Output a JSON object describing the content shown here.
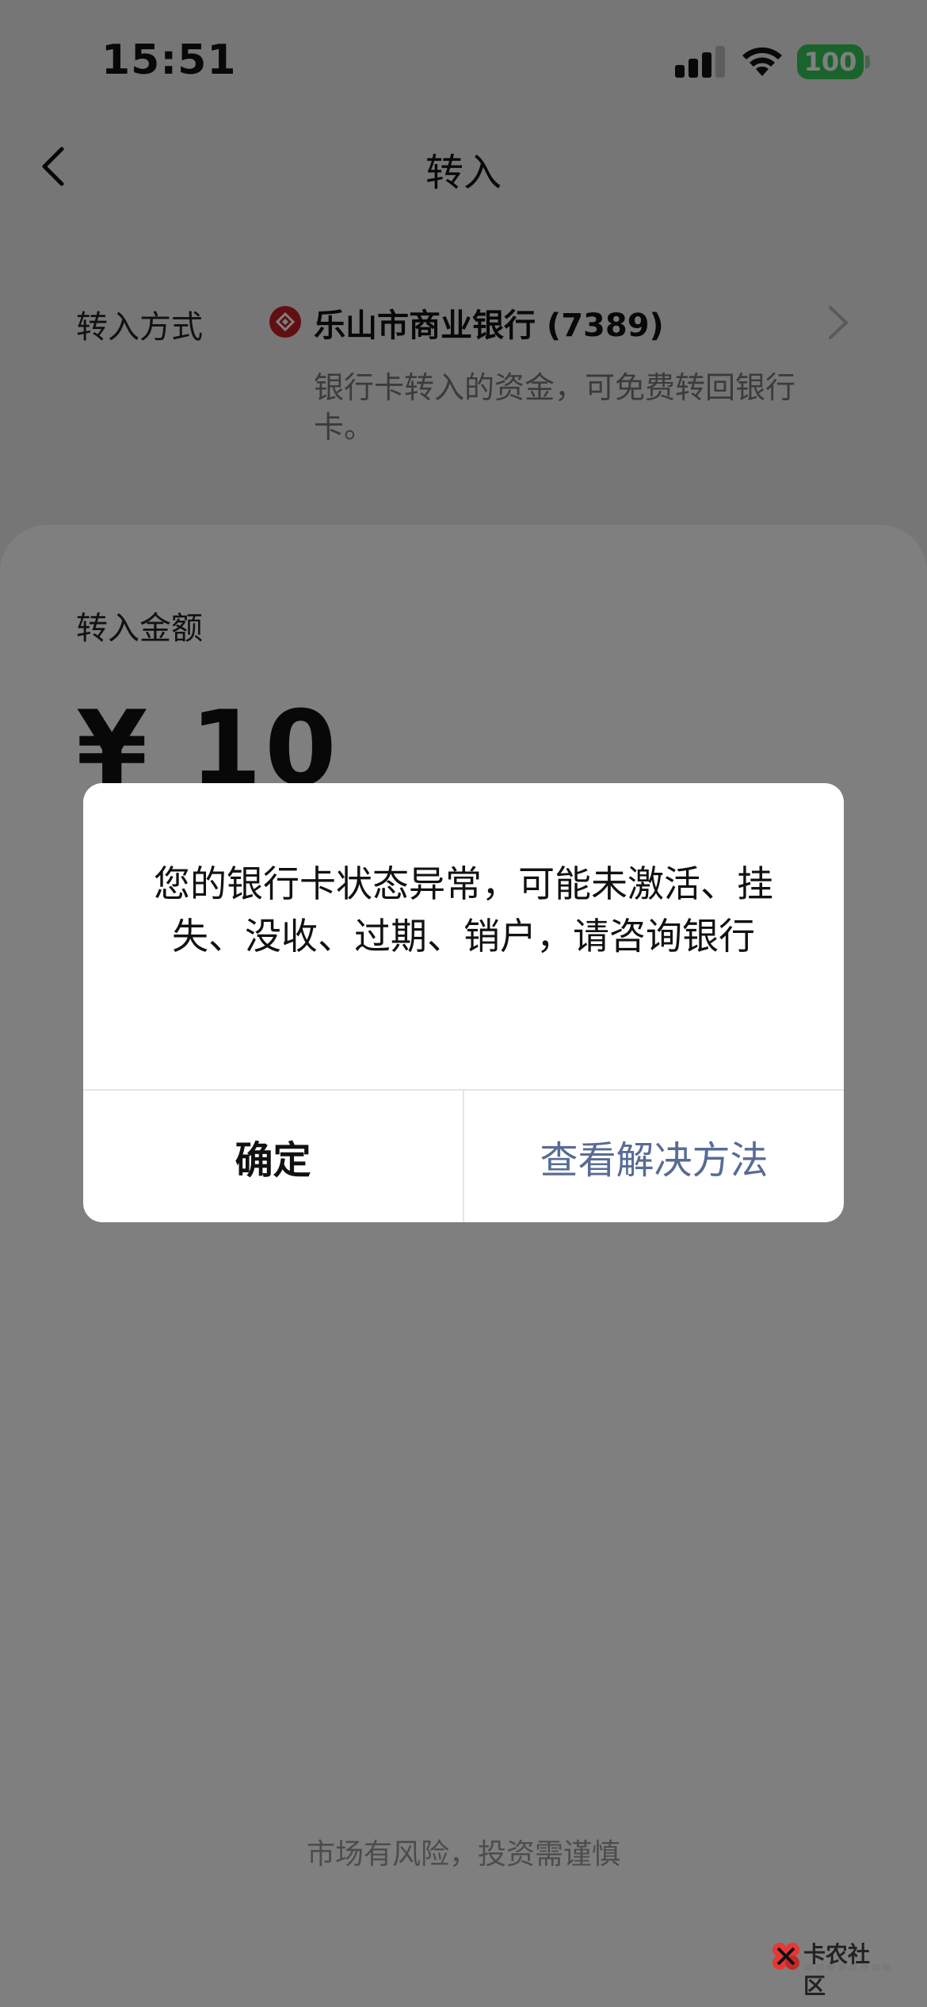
{
  "status_bar": {
    "time": "15:51",
    "battery": "100",
    "battery_color": "#34c759"
  },
  "nav": {
    "title": "转入",
    "back_icon": "chevron-left-icon"
  },
  "transfer_method": {
    "label": "转入方式",
    "bank_name": "乐山市商业银行 (7389)",
    "bank_logo_color": "#c41e24",
    "note": "银行卡转入的资金，可免费转回银行卡。"
  },
  "amount": {
    "label": "转入金额",
    "value": "¥ 10"
  },
  "footer": {
    "risk_note": "市场有风险，投资需谨慎"
  },
  "dialog": {
    "message": "您的银行卡状态异常，可能未激活、挂失、没收、过期、销户，请咨询银行",
    "confirm_label": "确定",
    "solution_label": "查看解决方法",
    "link_color": "#576b95"
  },
  "watermark": {
    "text": "卡农社区"
  }
}
